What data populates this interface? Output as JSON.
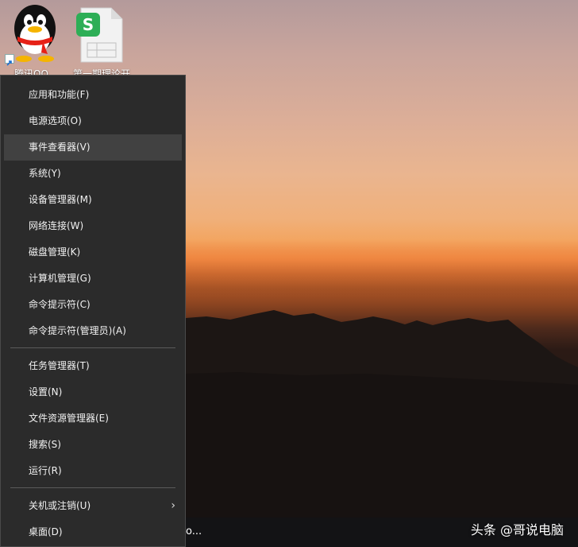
{
  "desktop": {
    "icons": [
      {
        "label": "腾讯QQ",
        "icon": "qq-penguin-icon"
      },
      {
        "label": "第一期理论开",
        "icon": "wps-spreadsheet-icon"
      }
    ]
  },
  "menu": {
    "groups": [
      {
        "items": [
          {
            "label": "应用和功能(F)"
          },
          {
            "label": "电源选项(O)"
          },
          {
            "label": "事件查看器(V)",
            "hovered": true
          },
          {
            "label": "系统(Y)"
          },
          {
            "label": "设备管理器(M)"
          },
          {
            "label": "网络连接(W)"
          },
          {
            "label": "磁盘管理(K)"
          },
          {
            "label": "计算机管理(G)"
          },
          {
            "label": "命令提示符(C)"
          },
          {
            "label": "命令提示符(管理员)(A)"
          }
        ]
      },
      {
        "items": [
          {
            "label": "任务管理器(T)"
          },
          {
            "label": "设置(N)"
          },
          {
            "label": "文件资源管理器(E)"
          },
          {
            "label": "搜索(S)"
          },
          {
            "label": "运行(R)"
          }
        ]
      },
      {
        "items": [
          {
            "label": "关机或注销(U)",
            "has_submenu": true
          },
          {
            "label": "桌面(D)"
          }
        ]
      }
    ]
  },
  "taskbar": {
    "partial_text": "o..."
  },
  "watermark": {
    "text": "头条 @哥说电脑"
  },
  "colors": {
    "menu_bg": "#2b2b2b",
    "menu_hover": "#414141",
    "menu_text": "#f2f2f2",
    "separator": "#5a5a5a"
  }
}
